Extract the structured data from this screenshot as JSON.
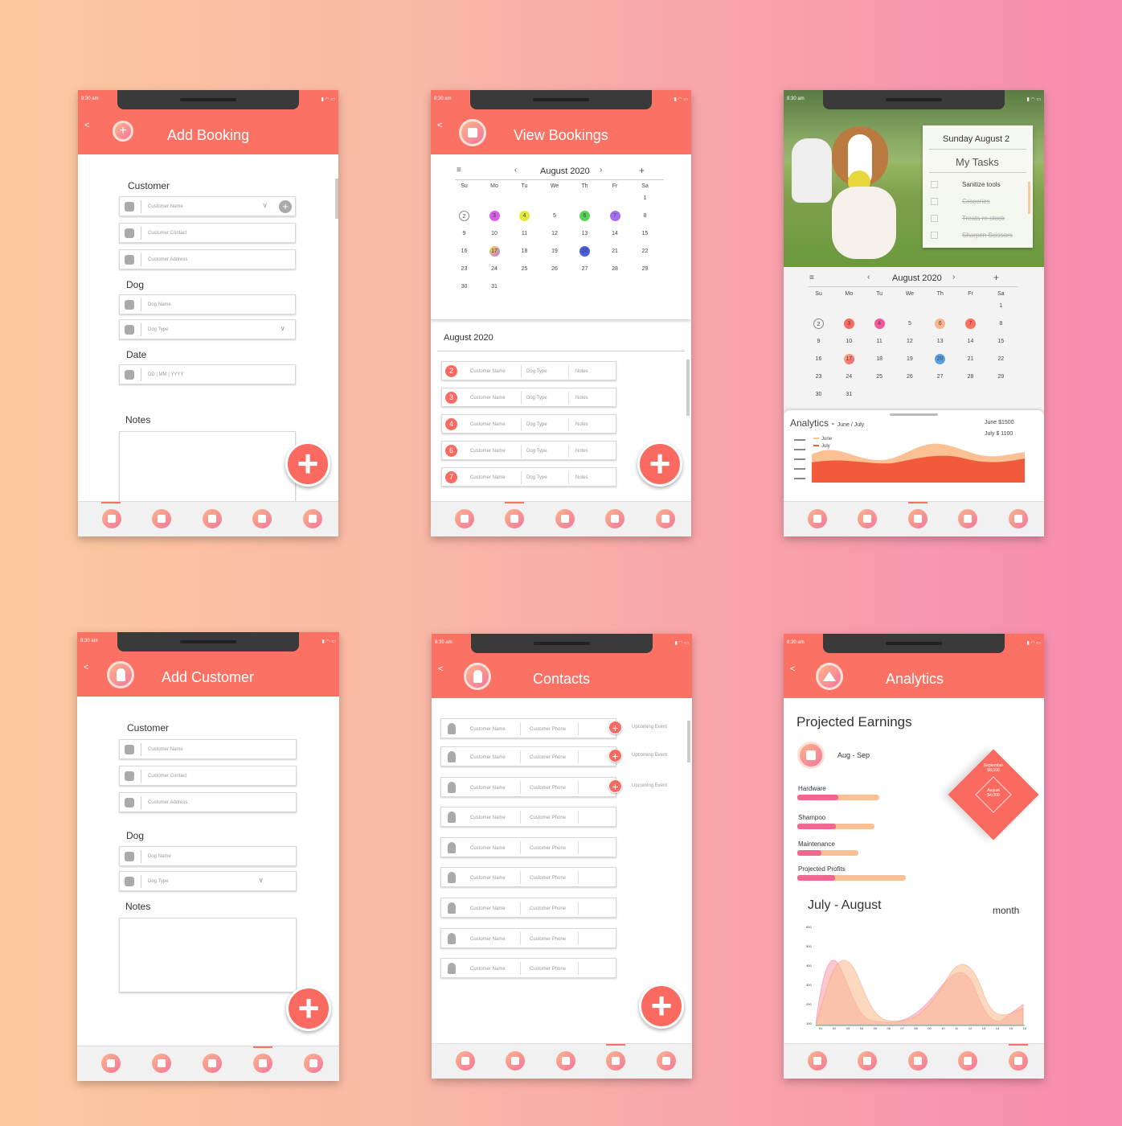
{
  "status_time": "8:30 am",
  "nav_items": [
    "add-icon",
    "bookings-icon",
    "home-icon",
    "customer-icon",
    "analytics-icon"
  ],
  "add_booking": {
    "title": "Add Booking",
    "back": "<",
    "customer_label": "Customer",
    "customer_name": "Customer Name",
    "customer_contact": "Customer Contact",
    "customer_address": "Customer Address",
    "dog_label": "Dog",
    "dog_name": "Dog Name",
    "dog_type": "Dog Type",
    "date_label": "Date",
    "date_placeholder": "DD | MM | YYYY",
    "notes_label": "Notes"
  },
  "view_bookings": {
    "title": "View Bookings",
    "back": "<",
    "month": "August 2020",
    "list_month": "August 2020",
    "weekdays": [
      "Su",
      "Mo",
      "Tu",
      "We",
      "Th",
      "Fr",
      "Sa"
    ],
    "bookings": [
      {
        "num": "2",
        "name": "Customer Name",
        "type": "Dog Type",
        "notes": "Notes"
      },
      {
        "num": "3",
        "name": "Customer Name",
        "type": "Dog Type",
        "notes": "Notes"
      },
      {
        "num": "4",
        "name": "Customer Name",
        "type": "Dog Type",
        "notes": "Notes"
      },
      {
        "num": "6",
        "name": "Customer Name",
        "type": "Dog Type",
        "notes": "Notes"
      },
      {
        "num": "7",
        "name": "Customer Name",
        "type": "Dog Type",
        "notes": "Notes"
      }
    ]
  },
  "home": {
    "date": "Sunday August 2",
    "tasks_title": "My Tasks",
    "tasks": [
      "Sanitize tools",
      "Groceries",
      "Treats re-stock",
      "Sharpen Scissors"
    ],
    "month": "August 2020",
    "weekdays": [
      "Su",
      "Mo",
      "Tu",
      "We",
      "Th",
      "Fr",
      "Sa"
    ],
    "analytics_title": "Analytics -",
    "analytics_period": "June / July",
    "legend": [
      "June",
      "July"
    ],
    "june_total": "June  $1500",
    "july_total": "July   $ 1100"
  },
  "add_customer": {
    "title": "Add Customer",
    "back": "<",
    "customer_label": "Customer",
    "customer_name": "Customer Name",
    "customer_contact": "Customer Contact",
    "customer_address": "Customer Address",
    "dog_label": "Dog",
    "dog_name": "Dog Name",
    "dog_type": "Dog Type",
    "notes_label": "Notes"
  },
  "contacts": {
    "title": "Contacts",
    "back": "<",
    "name": "Customer Name",
    "phone": "Customer Phone",
    "upcoming": "Upcoming Event"
  },
  "analytics": {
    "title": "Analytics",
    "back": "<",
    "projected": "Projected Earnings",
    "range": "Aug - Sep",
    "bars": [
      {
        "label": "Hardware",
        "value": 0.5
      },
      {
        "label": "Shampoo",
        "value": 0.5
      },
      {
        "label": "Maintenance",
        "value": 0.4
      },
      {
        "label": "Projected Profits",
        "value": 0.35
      }
    ],
    "sept_label": "September",
    "sept_value": "$8,000",
    "aug_label": "August",
    "aug_value": "$4,000",
    "period": "July - August",
    "unit": "month",
    "yticks": [
      "600",
      "500",
      "400",
      "300",
      "200",
      "100"
    ],
    "xticks": [
      "01",
      "02",
      "03",
      "04",
      "05",
      "06",
      "07",
      "08",
      "09",
      "10",
      "11",
      "12",
      "13",
      "14",
      "15",
      "16"
    ]
  }
}
